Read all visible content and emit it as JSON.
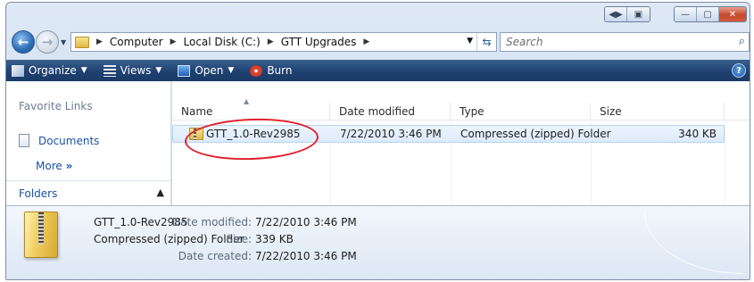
{
  "caption": {
    "groupA": [
      "◀▶",
      "▣"
    ],
    "groupB": [
      "—",
      "▢",
      "✕"
    ]
  },
  "nav": {
    "back_glyph": "←",
    "forward_glyph": "→",
    "breadcrumbs": [
      "Computer",
      "Local Disk (C:)",
      "GTT Upgrades"
    ],
    "search_placeholder": "Search"
  },
  "toolbar": {
    "organize": "Organize",
    "views": "Views",
    "open": "Open",
    "burn": "Burn",
    "help": "?"
  },
  "left_pane": {
    "favorite_links": "Favorite Links",
    "documents": "Documents",
    "more": "More",
    "more_glyph": "»",
    "folders": "Folders"
  },
  "columns": [
    "Name",
    "Date modified",
    "Type",
    "Size"
  ],
  "files": [
    {
      "name": "GTT_1.0-Rev2985",
      "date_modified": "7/22/2010 3:46 PM",
      "type": "Compressed (zipped) Folder",
      "size": "340 KB",
      "selected": true
    }
  ],
  "details": {
    "name": "GTT_1.0-Rev2985",
    "type": "Compressed (zipped) Folder",
    "date_modified_label": "Date modified:",
    "date_modified": "7/22/2010 3:46 PM",
    "size_label": "Size:",
    "size": "339 KB",
    "date_created_label": "Date created:",
    "date_created": "7/22/2010 3:46 PM"
  },
  "colors": {
    "toolbar_top": "#3a6090",
    "toolbar_bottom": "#1a3b66",
    "link_blue": "#1b52a3",
    "selection": "#dcebfc",
    "annotation_red": "#e0202a"
  }
}
